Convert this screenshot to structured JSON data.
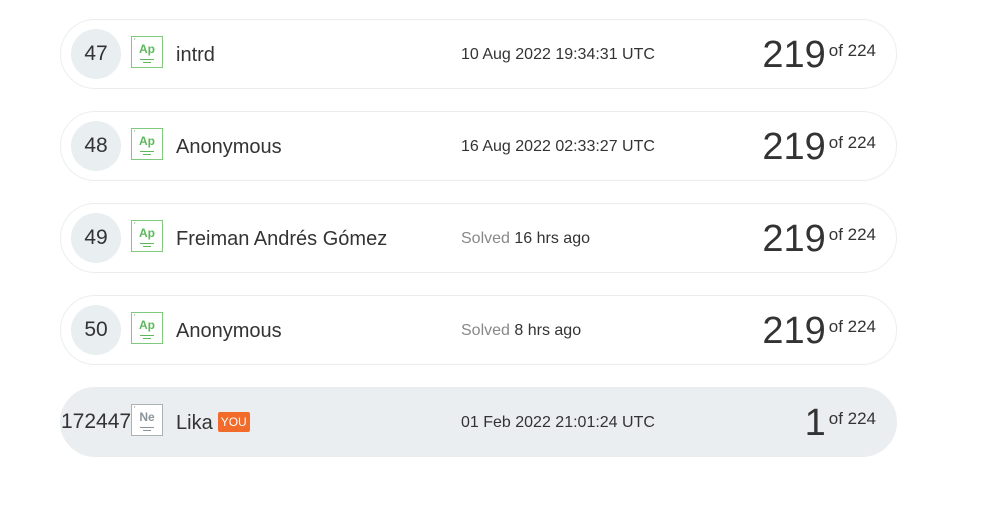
{
  "rows": [
    {
      "rank": "47",
      "badge_symbol": "Ap",
      "name": "intrd",
      "date_prefix": "",
      "date": "10 Aug 2022 19:34:31 UTC",
      "solved": "219",
      "of_total": "of 224"
    },
    {
      "rank": "48",
      "badge_symbol": "Ap",
      "name": "Anonymous",
      "date_prefix": "",
      "date": "16 Aug 2022 02:33:27 UTC",
      "solved": "219",
      "of_total": "of 224"
    },
    {
      "rank": "49",
      "badge_symbol": "Ap",
      "name": "Freiman Andrés Gómez",
      "date_prefix": "Solved",
      "date": "16 hrs ago",
      "solved": "219",
      "of_total": "of 224"
    },
    {
      "rank": "50",
      "badge_symbol": "Ap",
      "name": "Anonymous",
      "date_prefix": "Solved",
      "date": "8 hrs ago",
      "solved": "219",
      "of_total": "of 224"
    }
  ],
  "you_row": {
    "rank": "172447",
    "badge_symbol": "Ne",
    "name": "Lika",
    "you_tag": "YOU",
    "date": "01 Feb 2022 21:01:24 UTC",
    "solved": "1",
    "of_total": "of 224"
  },
  "colors": {
    "badge_green": "#5cb85c",
    "badge_grey": "#8a9499",
    "you_tag": "#f26b2a",
    "row_highlight": "#eaeef0"
  }
}
